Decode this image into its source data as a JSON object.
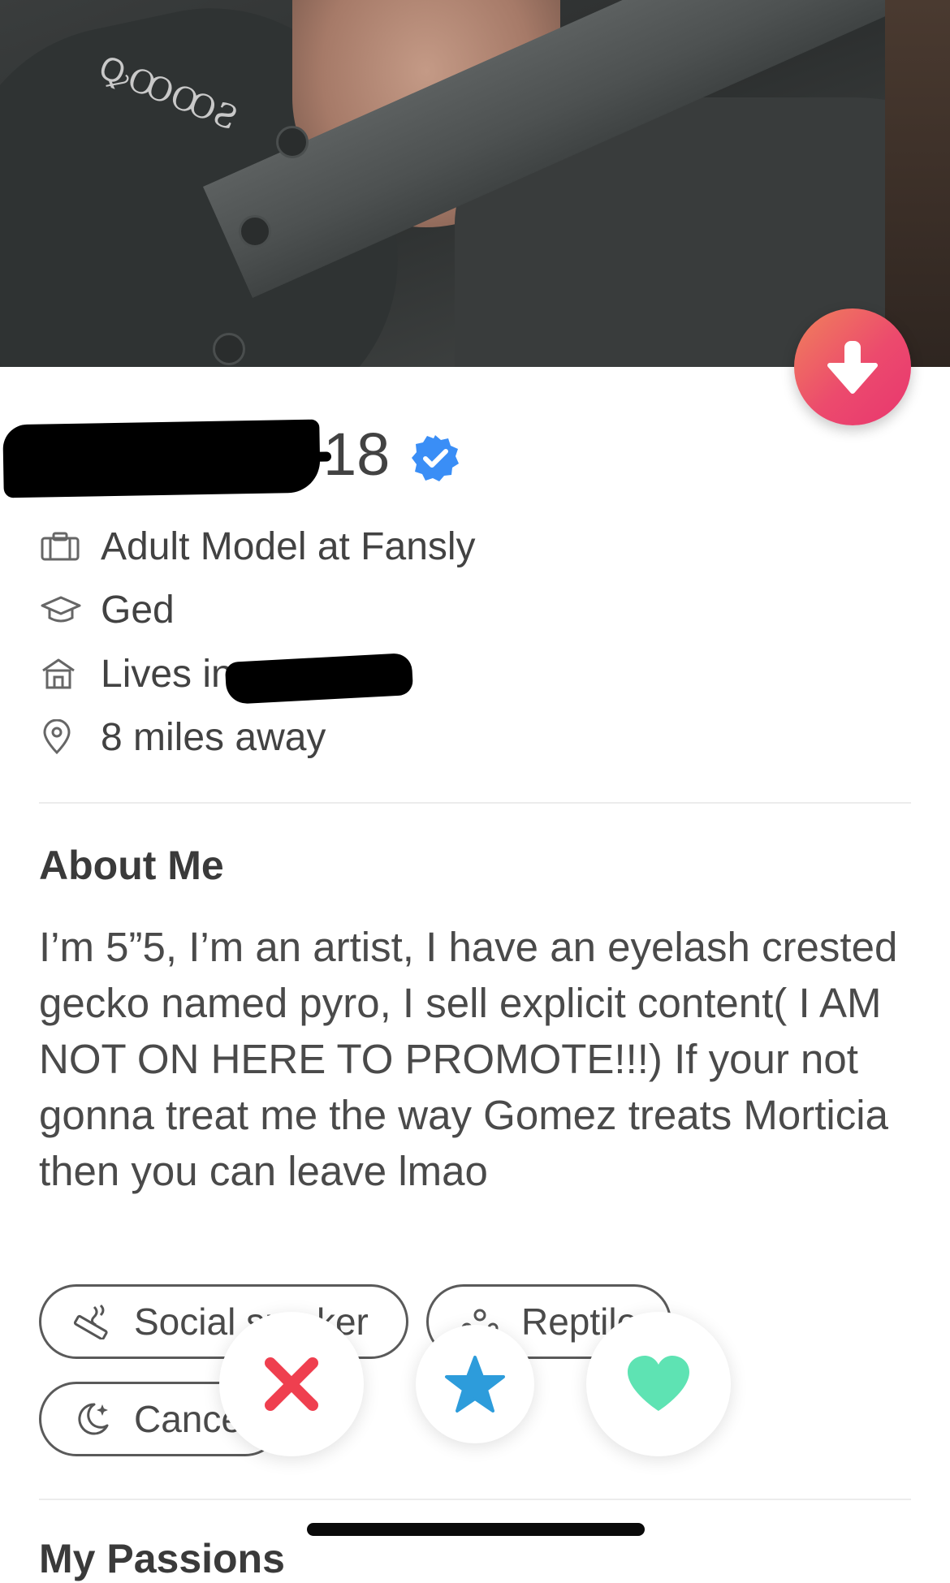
{
  "profile": {
    "age": "18",
    "verified_icon": "verified-check-icon",
    "job": "Adult Model at Fansly",
    "school": "Ged",
    "lives_in_prefix": "Lives in",
    "distance": "8 miles away"
  },
  "about": {
    "title": "About Me",
    "text": "I’m 5”5, I’m an artist, I have an eyelash crested gecko named pyro, I sell explicit content( I AM NOT ON HERE TO PROMOTE!!!) If your not gonna treat me the way Gomez treats Morticia then you can leave lmao"
  },
  "lifestyle": {
    "chips": [
      {
        "label": "Social smoker",
        "icon": "smoking-icon"
      },
      {
        "label": "Reptile",
        "icon": "paw-icon"
      },
      {
        "label": "Cancer",
        "icon": "moon-stars-icon"
      }
    ]
  },
  "next_section": {
    "title": "My Passions"
  },
  "colors": {
    "fab_gradient_start": "#f0825b",
    "fab_gradient_end": "#e8366f",
    "nope": "#ef3f4f",
    "super_like": "#2d9cdb",
    "like": "#5ee3b3",
    "verified": "#3a8ef6"
  }
}
